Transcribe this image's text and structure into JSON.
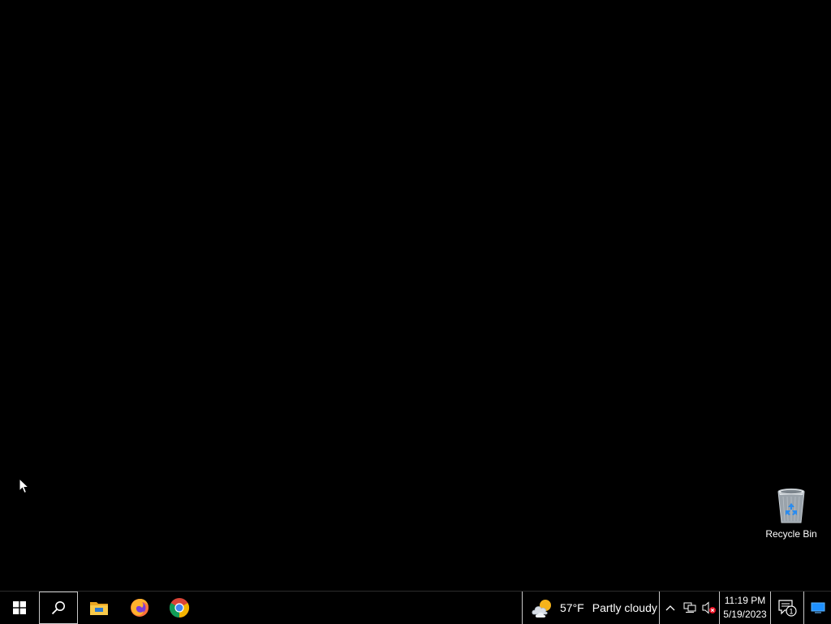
{
  "desktop": {
    "background_color": "#000000",
    "icons": [
      {
        "label": "Recycle Bin",
        "icon": "recycle-bin-icon"
      }
    ]
  },
  "taskbar": {
    "start": {
      "icon": "windows-logo-icon"
    },
    "search": {
      "icon": "search-icon"
    },
    "pinned_apps": [
      {
        "name": "File Explorer",
        "icon": "folder-icon"
      },
      {
        "name": "Firefox",
        "icon": "firefox-icon"
      },
      {
        "name": "Google Chrome",
        "icon": "chrome-icon"
      }
    ],
    "weather": {
      "icon": "partly-cloudy-icon",
      "temperature": "57°F",
      "condition": "Partly cloudy"
    },
    "tray": {
      "chevron_icon": "chevron-up-icon",
      "network_icon": "network-icon",
      "volume_icon": "volume-muted-icon"
    },
    "clock": {
      "time": "11:19 PM",
      "date": "5/19/2023"
    },
    "action_center": {
      "icon": "notification-icon",
      "badge_count": "1"
    },
    "show_desktop": {
      "icon": "show-desktop-icon"
    },
    "accent_color": "#1e90ff"
  }
}
